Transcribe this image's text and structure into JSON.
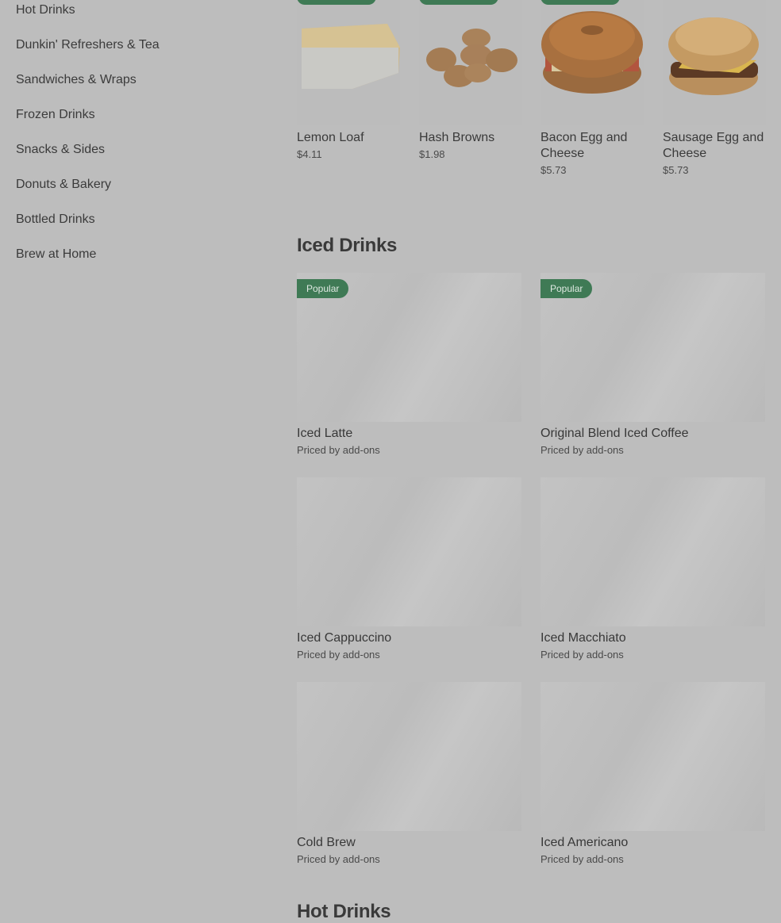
{
  "sidebar": {
    "items": [
      {
        "label": "Hot Drinks"
      },
      {
        "label": "Dunkin' Refreshers & Tea"
      },
      {
        "label": "Sandwiches & Wraps"
      },
      {
        "label": "Frozen Drinks"
      },
      {
        "label": "Snacks & Sides"
      },
      {
        "label": "Donuts & Bakery"
      },
      {
        "label": "Bottled Drinks"
      },
      {
        "label": "Brew at Home"
      }
    ]
  },
  "top_items": [
    {
      "name": "Lemon Loaf",
      "price": "$4.11"
    },
    {
      "name": "Hash Browns",
      "price": "$1.98"
    },
    {
      "name": "Bacon Egg and Cheese",
      "price": "$5.73"
    },
    {
      "name": "Sausage Egg and Cheese",
      "price": "$5.73"
    }
  ],
  "iced_section": {
    "title": "Iced Drinks",
    "items": [
      {
        "name": "Iced Latte",
        "sub": "Priced by add-ons",
        "badge": "Popular"
      },
      {
        "name": "Original Blend Iced Coffee",
        "sub": "Priced by add-ons",
        "badge": "Popular"
      },
      {
        "name": "Iced Cappuccino",
        "sub": "Priced by add-ons"
      },
      {
        "name": "Iced Macchiato",
        "sub": "Priced by add-ons"
      },
      {
        "name": "Cold Brew",
        "sub": "Priced by add-ons"
      },
      {
        "name": "Iced Americano",
        "sub": "Priced by add-ons"
      }
    ]
  },
  "next_section": {
    "title": "Hot Drinks"
  },
  "colors": {
    "accent": "#3f7a55",
    "overlay": "#bdbdbd"
  }
}
